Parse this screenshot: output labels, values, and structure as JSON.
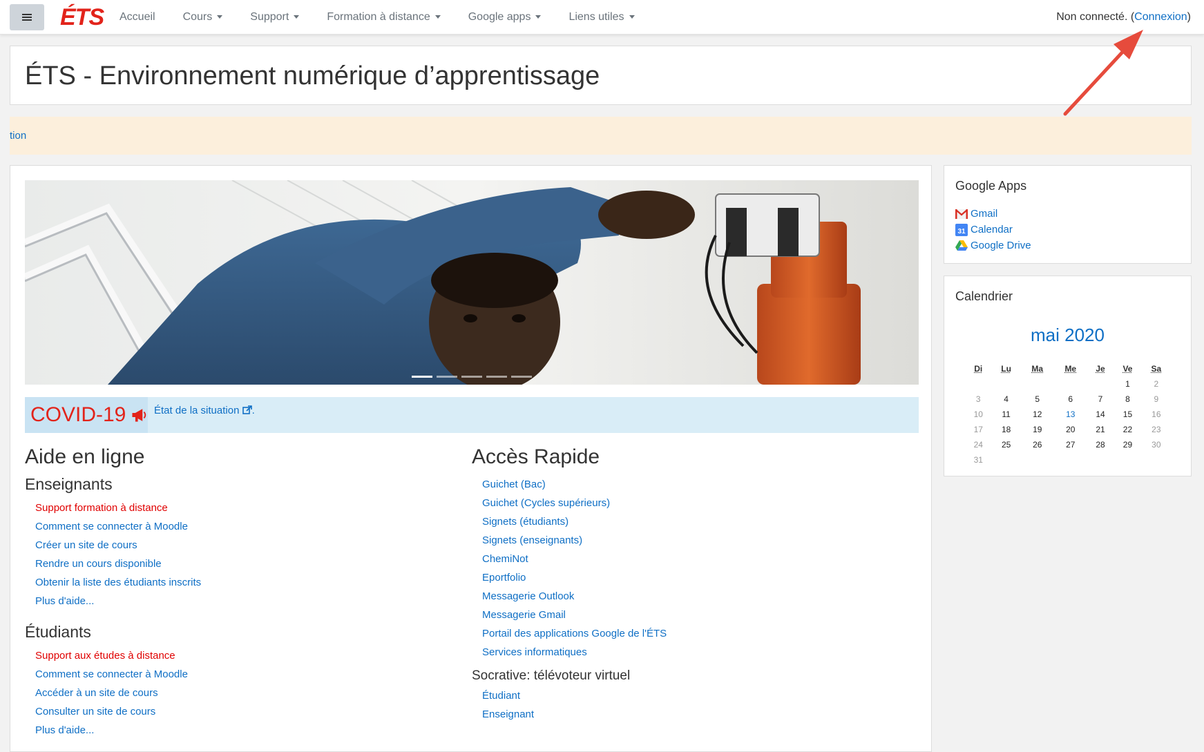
{
  "navbar": {
    "logo": "ÉTS",
    "items": [
      {
        "label": "Accueil",
        "dropdown": false
      },
      {
        "label": "Cours",
        "dropdown": true
      },
      {
        "label": "Support",
        "dropdown": true
      },
      {
        "label": "Formation à distance",
        "dropdown": true
      },
      {
        "label": "Google apps",
        "dropdown": true
      },
      {
        "label": "Liens utiles",
        "dropdown": true
      }
    ],
    "login_status": "Non connecté. (",
    "login_link": "Connexion",
    "login_close": ")"
  },
  "header": {
    "title": "ÉTS - Environnement numérique d’apprentissage"
  },
  "alert": {
    "text": "tion"
  },
  "covid": {
    "label": "COVID-19",
    "link": "État de la situation"
  },
  "aide": {
    "title": "Aide en ligne",
    "enseignants": {
      "title": "Enseignants",
      "links": [
        {
          "label": "Support formation à distance",
          "red": true
        },
        {
          "label": "Comment se connecter à Moodle",
          "red": false
        },
        {
          "label": "Créer un site de cours",
          "red": false
        },
        {
          "label": "Rendre un cours disponible",
          "red": false
        },
        {
          "label": "Obtenir la liste des étudiants inscrits",
          "red": false
        },
        {
          "label": "Plus d'aide...",
          "red": false
        }
      ]
    },
    "etudiants": {
      "title": "Étudiants",
      "links": [
        {
          "label": "Support aux études à distance",
          "red": true
        },
        {
          "label": "Comment se connecter à Moodle",
          "red": false
        },
        {
          "label": "Accéder à un site de cours",
          "red": false
        },
        {
          "label": "Consulter un site de cours",
          "red": false
        },
        {
          "label": "Plus d'aide...",
          "red": false
        }
      ]
    }
  },
  "acces": {
    "title": "Accès Rapide",
    "links": [
      "Guichet (Bac)",
      "Guichet (Cycles supérieurs)",
      "Signets (étudiants)",
      "Signets (enseignants)",
      "ChemiNot",
      "Eportfolio",
      "Messagerie Outlook",
      "Messagerie Gmail",
      "Portail des applications Google de l'ÉTS",
      "Services informatiques"
    ],
    "socrative": {
      "title": "Socrative: télévoteur virtuel",
      "links": [
        "Étudiant",
        "Enseignant"
      ]
    }
  },
  "google_apps": {
    "title": "Google Apps",
    "links": [
      {
        "label": "Gmail",
        "icon": "gmail-icon"
      },
      {
        "label": "Calendar",
        "icon": "calendar-icon"
      },
      {
        "label": "Google Drive",
        "icon": "drive-icon"
      }
    ]
  },
  "calendar": {
    "title": "Calendrier",
    "month": "mai 2020",
    "weekdays": [
      "Di",
      "Lu",
      "Ma",
      "Me",
      "Je",
      "Ve",
      "Sa"
    ],
    "weeks": [
      [
        "",
        "",
        "",
        "",
        "",
        "1",
        "2"
      ],
      [
        "3",
        "4",
        "5",
        "6",
        "7",
        "8",
        "9"
      ],
      [
        "10",
        "11",
        "12",
        "13",
        "14",
        "15",
        "16"
      ],
      [
        "17",
        "18",
        "19",
        "20",
        "21",
        "22",
        "23"
      ],
      [
        "24",
        "25",
        "26",
        "27",
        "28",
        "29",
        "30"
      ],
      [
        "31",
        "",
        "",
        "",
        "",
        "",
        ""
      ]
    ],
    "today": "13"
  },
  "colors": {
    "link": "#0f6fc5",
    "accent_red": "#e2231a",
    "alert_bg": "#fcefdc",
    "covid_bg": "#d9edf7"
  }
}
